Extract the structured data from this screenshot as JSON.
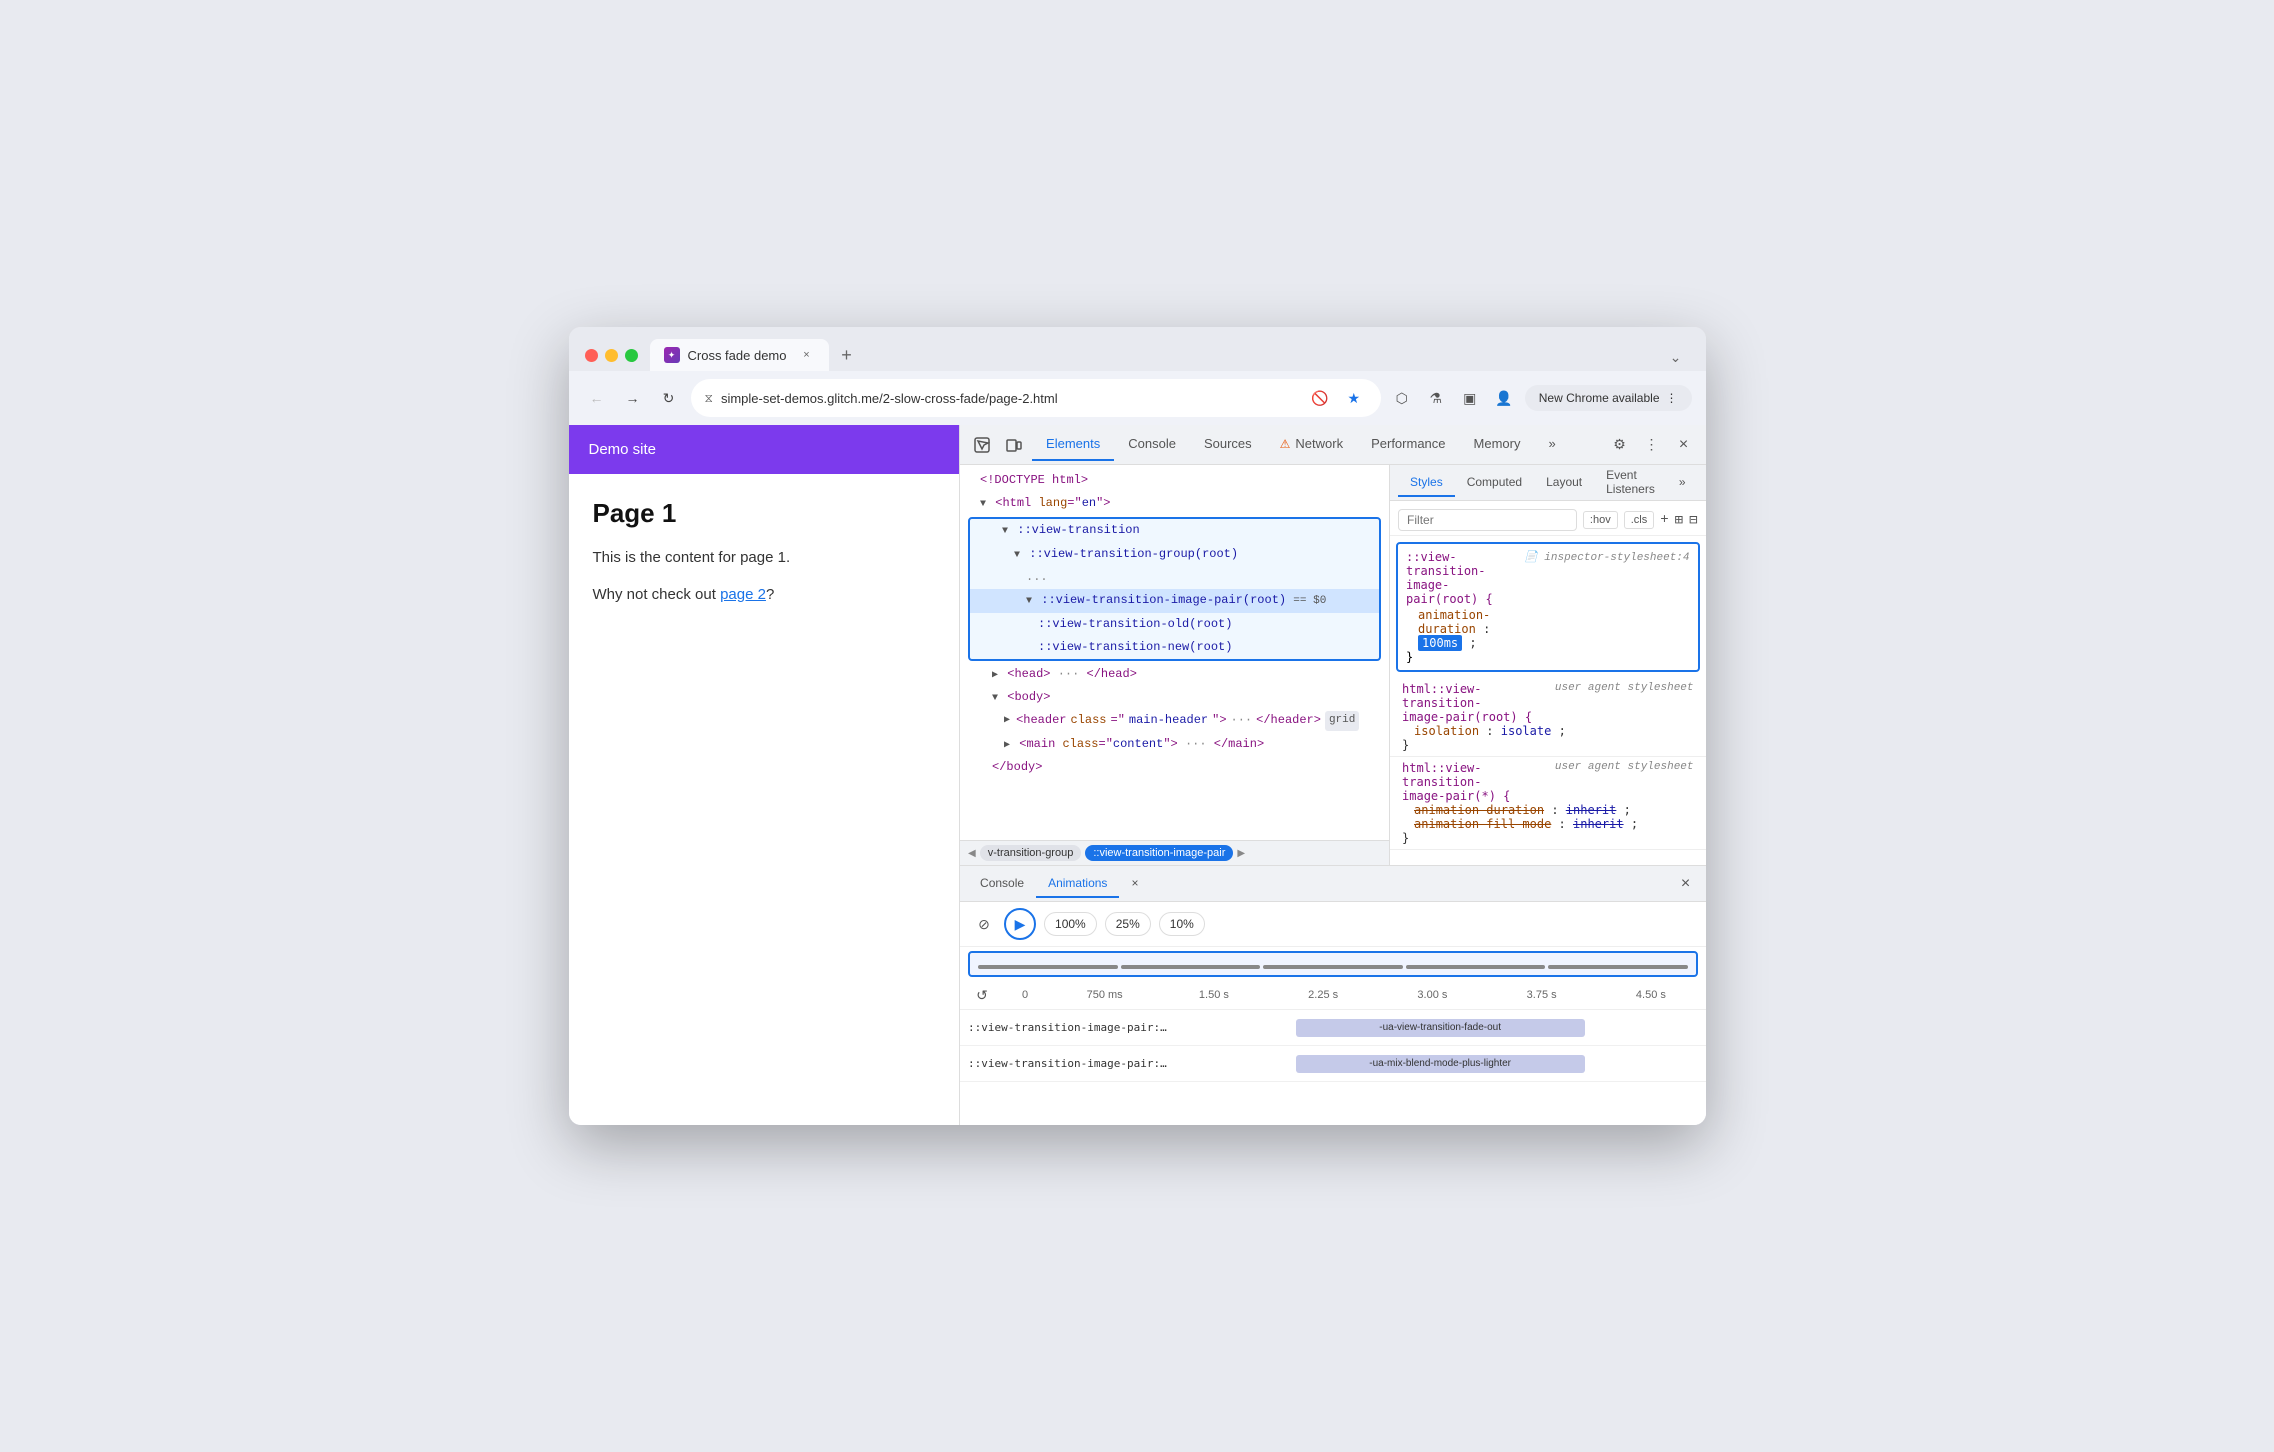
{
  "browser": {
    "tab_title": "Cross fade demo",
    "tab_favicon_text": "✦",
    "tab_close_label": "×",
    "new_tab_label": "+",
    "chevron_label": "⌄",
    "nav": {
      "back_label": "←",
      "forward_label": "→",
      "reload_label": "↻",
      "address_icon_label": "⧖",
      "address_text": "simple-set-demos.glitch.me/2-slow-cross-fade/page-2.html",
      "eye_off_icon": "👁",
      "star_icon": "★",
      "share_icon": "⬡",
      "flask_icon": "⚗",
      "sidebar_icon": "⬜",
      "profile_icon": "👤",
      "new_chrome_label": "New Chrome available",
      "new_chrome_dots": "⋮"
    }
  },
  "demo_page": {
    "header_title": "Demo site",
    "page_heading": "Page 1",
    "content_text": "This is the content for page 1.",
    "link_text_prefix": "Why not check out ",
    "link_text": "page 2",
    "link_text_suffix": "?"
  },
  "devtools": {
    "toolbar": {
      "select_tool": "⬚",
      "device_tool": "⬜",
      "tabs": [
        {
          "label": "Elements",
          "active": true
        },
        {
          "label": "Console",
          "active": false
        },
        {
          "label": "Sources",
          "active": false
        },
        {
          "label": "Network",
          "active": false,
          "warning": "⚠"
        },
        {
          "label": "Performance",
          "active": false
        },
        {
          "label": "Memory",
          "active": false
        },
        {
          "label": "»",
          "active": false
        }
      ],
      "settings_icon": "⚙",
      "more_icon": "⋮",
      "close_icon": "×"
    },
    "elements_panel": {
      "lines": [
        {
          "text": "<!DOCTYPE html>",
          "indent": 1,
          "type": "doctype"
        },
        {
          "text": "<html lang=\"en\">",
          "indent": 1,
          "type": "tag"
        },
        {
          "text": "::view-transition",
          "indent": 2,
          "type": "pseudo",
          "collapse": "▼"
        },
        {
          "text": "::view-transition-group(root)",
          "indent": 3,
          "type": "pseudo",
          "collapse": "▼"
        },
        {
          "text": "...",
          "indent": 4,
          "type": "dots"
        },
        {
          "text": "::view-transition-image-pair(root) == $0",
          "indent": 4,
          "type": "pseudo",
          "collapse": "▼"
        },
        {
          "text": "::view-transition-old(root)",
          "indent": 5,
          "type": "pseudo"
        },
        {
          "text": "::view-transition-new(root)",
          "indent": 5,
          "type": "pseudo"
        },
        {
          "text": "<head>",
          "indent": 2,
          "type": "tag",
          "collapse": "▶"
        },
        {
          "text": "<body>",
          "indent": 2,
          "type": "tag",
          "collapse": "▼"
        },
        {
          "text": "<header class=\"main-header\">",
          "indent": 3,
          "type": "tag",
          "collapse": "▶",
          "has_badge": true,
          "badge_text": "grid"
        },
        {
          "text": "<main class=\"content\">",
          "indent": 3,
          "type": "tag",
          "collapse": "▶"
        },
        {
          "text": "</body>",
          "indent": 2,
          "type": "closing"
        }
      ]
    },
    "breadcrumb": {
      "left_arrow": "◀",
      "items": [
        {
          "label": "v-transition-group",
          "active": false
        },
        {
          "label": "::view-transition-image-pair",
          "active": true
        }
      ],
      "right_arrow": "▶"
    },
    "styles_panel": {
      "tabs": [
        {
          "label": "Styles",
          "active": true
        },
        {
          "label": "Computed",
          "active": false
        },
        {
          "label": "Layout",
          "active": false
        },
        {
          "label": "Event Listeners",
          "active": false
        },
        {
          "label": "»",
          "active": false
        }
      ],
      "filter_placeholder": "Filter",
      "pseudo_hov": ":hov",
      "pseudo_cls": ".cls",
      "add_icon": "+",
      "copy_icon": "⊞",
      "more_icon": "⊟",
      "css_blocks": [
        {
          "highlighted": true,
          "selector": "::view-transition-image-pair(root) {",
          "source": "inspector-stylesheet:4",
          "properties": [
            {
              "name": "animation-duration",
              "value": "100ms",
              "value_highlighted": true,
              "strikethrough": false
            }
          ],
          "close": "}"
        },
        {
          "highlighted": false,
          "selector": "html::view-transition-image-pair(root) {",
          "source": "user agent stylesheet",
          "properties": [
            {
              "name": "isolation",
              "value": "isolate",
              "strikethrough": false
            }
          ],
          "close": "}"
        },
        {
          "highlighted": false,
          "selector": "html::view-transition-image-pair(*) {",
          "source": "user agent stylesheet",
          "properties": [
            {
              "name": "animation-duration",
              "value": "inherit",
              "strikethrough": true
            },
            {
              "name": "animation-fill-mode",
              "value": "inherit",
              "strikethrough": true
            }
          ],
          "close": "}"
        }
      ]
    },
    "bottom_drawer": {
      "tabs": [
        {
          "label": "Console",
          "active": false
        },
        {
          "label": "Animations",
          "active": true
        },
        {
          "label": "×",
          "is_close": false
        }
      ],
      "close_label": "×",
      "animations_toolbar": {
        "clear_icon": "⊘",
        "play_icon": "▶",
        "speed_100": "100%",
        "speed_25": "25%",
        "speed_10": "10%"
      },
      "timeline": {
        "reload_icon": "↺",
        "marks": [
          "0",
          "750 ms",
          "1.50 s",
          "2.25 s",
          "3.00 s",
          "3.75 s",
          "4.50 s"
        ],
        "tracks": [
          {
            "label": "::view-transition-image-pair::view-tra",
            "bar_label": "-ua-view-transition-fade-out",
            "bar_left_pct": 22,
            "bar_width_pct": 55
          },
          {
            "label": "::view-transition-image-pair::view-tra",
            "bar_label": "-ua-mix-blend-mode-plus-lighter",
            "bar_left_pct": 22,
            "bar_width_pct": 55
          }
        ]
      }
    }
  }
}
